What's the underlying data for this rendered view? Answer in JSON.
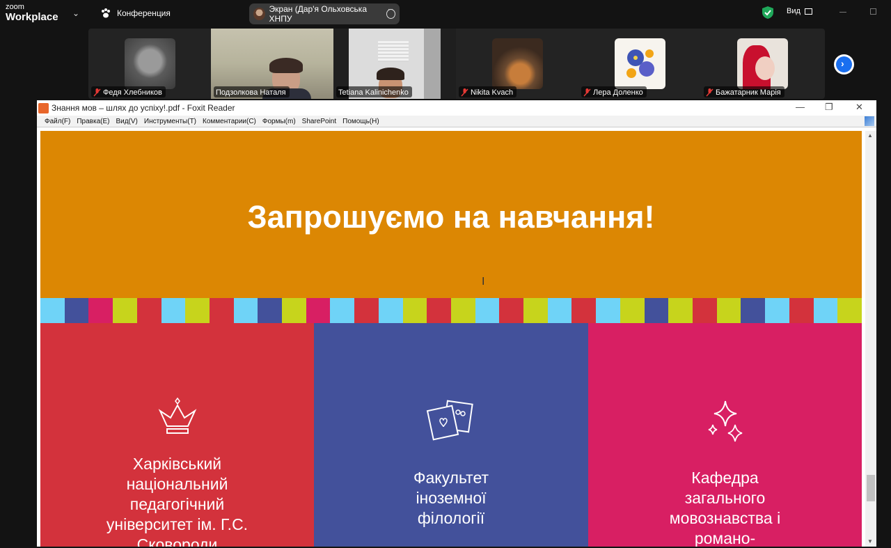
{
  "zoom": {
    "logo_small": "zoom",
    "logo_big": "Workplace",
    "conference_label": "Конференция",
    "share_label": "Экран (Дар'я Ольховська ХНПУ",
    "view_label": "Вид"
  },
  "participants": [
    {
      "name": "Федя Хлебников",
      "muted": true
    },
    {
      "name": "Подзолкова Наталя",
      "muted": false
    },
    {
      "name": "Tetiana Kalinichenko",
      "muted": false,
      "active": true
    },
    {
      "name": "Nikita Kvach",
      "muted": true
    },
    {
      "name": "Лера Доленко",
      "muted": true
    },
    {
      "name": "Бажатарник Марія",
      "muted": true
    }
  ],
  "foxit": {
    "title": "Знання мов – шлях до успіху!.pdf - Foxit Reader",
    "menu": [
      "Файл(F)",
      "Правка(E)",
      "Вид(V)",
      "Инструменты(T)",
      "Комментарии(C)",
      "Формы(m)",
      "SharePoint",
      "Помощь(H)"
    ]
  },
  "document": {
    "heading": "Запрошуємо на навчання!",
    "columns": [
      {
        "lines": [
          "Харківський",
          "національний",
          "педагогічний",
          "університет ім. Г.С.",
          "Сковороди"
        ],
        "color": "#d3323c",
        "icon": "crown-icon"
      },
      {
        "lines": [
          "Факультет",
          "іноземної",
          "філології"
        ],
        "color": "#43519b",
        "icon": "photos-icon"
      },
      {
        "lines": [
          "Кафедра",
          "загального",
          "мовознавства і",
          "романо-"
        ],
        "color": "#d81f63",
        "icon": "sparkles-icon"
      }
    ],
    "stripe_colors": [
      "#6fd3f7",
      "#43519b",
      "#d81f63",
      "#c7d41c",
      "#d3323c",
      "#6fd3f7",
      "#c7d41c",
      "#d3323c",
      "#6fd3f7",
      "#43519b",
      "#c7d41c",
      "#d81f63",
      "#6fd3f7",
      "#d3323c",
      "#6fd3f7",
      "#c7d41c",
      "#d3323c",
      "#c7d41c",
      "#6fd3f7",
      "#d3323c",
      "#c7d41c",
      "#6fd3f7",
      "#d3323c",
      "#6fd3f7",
      "#c7d41c",
      "#43519b",
      "#c7d41c",
      "#d3323c",
      "#c7d41c",
      "#43519b",
      "#6fd3f7",
      "#d3323c",
      "#6fd3f7",
      "#c7d41c"
    ]
  }
}
